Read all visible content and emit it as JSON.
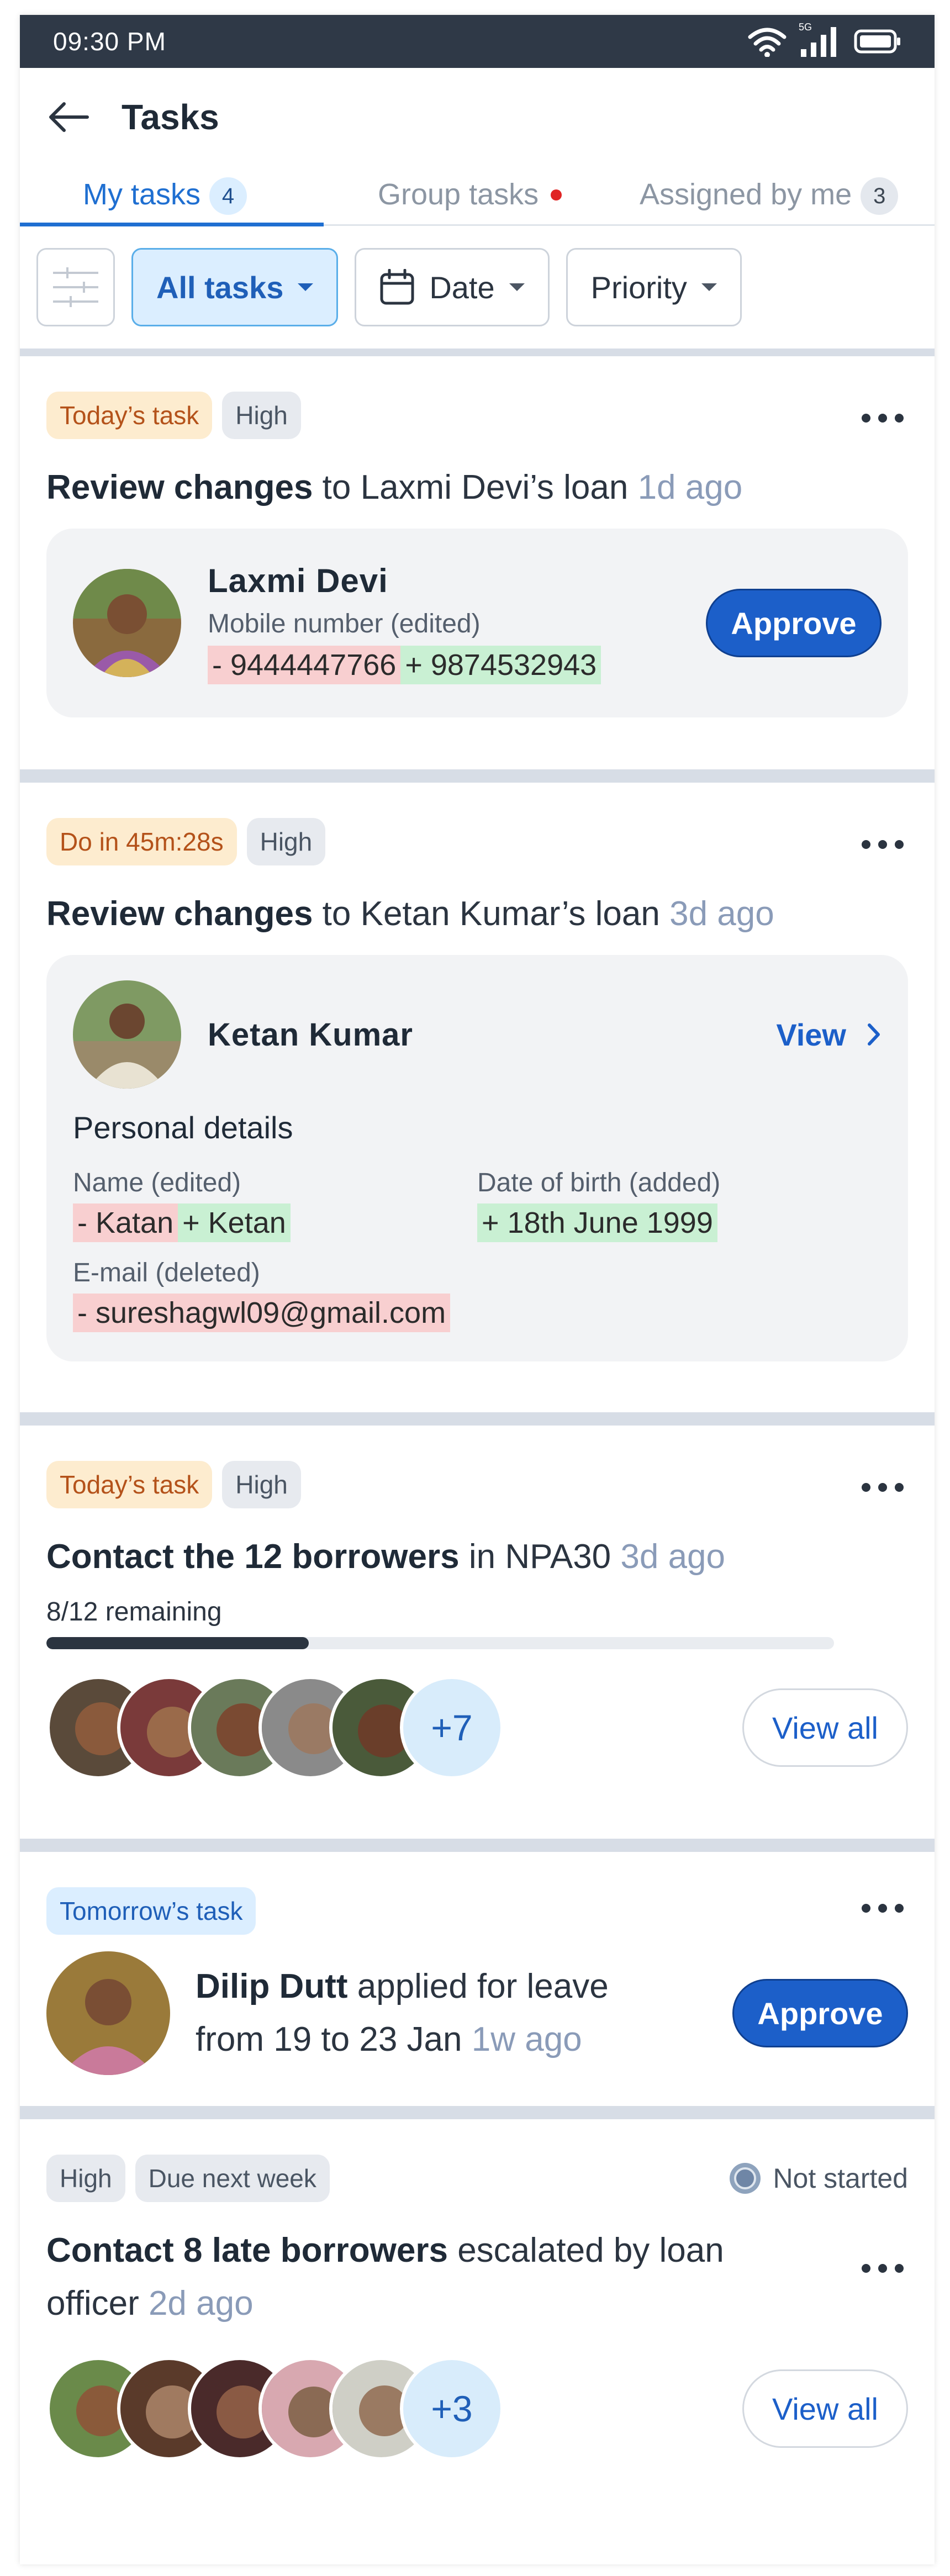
{
  "status_bar": {
    "time": "09:30 PM",
    "network": "5G"
  },
  "app_bar": {
    "title": "Tasks"
  },
  "tabs": [
    {
      "label": "My tasks",
      "count": "4",
      "active": true
    },
    {
      "label": "Group tasks",
      "has_dot": true,
      "active": false
    },
    {
      "label": "Assigned by me",
      "count": "3",
      "active": false
    }
  ],
  "filters": {
    "all_tasks": "All tasks",
    "date": "Date",
    "priority": "Priority"
  },
  "cards": [
    {
      "tag1": "Today’s task",
      "tag2": "High",
      "title_bold": "Review changes",
      "title_rest": " to Laxmi Devi’s loan ",
      "ago": "1d ago",
      "person": "Laxmi Devi",
      "field_label": "Mobile number (edited)",
      "old_value": "- 9444447766",
      "new_value": "+ 9874532943",
      "action": "Approve"
    },
    {
      "tag1": "Do in 45m:28s",
      "tag2": "High",
      "title_bold": "Review changes",
      "title_rest": " to Ketan Kumar’s loan ",
      "ago": "3d ago",
      "person": "Ketan Kumar",
      "view_label": "View",
      "section": "Personal details",
      "name_label": "Name (edited)",
      "name_old": "- Katan",
      "name_new": "+ Ketan",
      "dob_label": "Date of birth (added)",
      "dob_new": "+ 18th June 1999",
      "email_label": "E-mail (deleted)",
      "email_old": "- sureshagwl09@gmail.com"
    },
    {
      "tag1": "Today’s task",
      "tag2": "High",
      "title_bold": "Contact the 12 borrowers",
      "title_rest": " in NPA30 ",
      "ago": "3d ago",
      "progress_text": "8/12 remaining",
      "progress_fraction": 0.333,
      "extra_count": "+7",
      "action": "View all"
    },
    {
      "tag1": "Tomorrow’s task",
      "person": "Dilip Dutt",
      "line1_rest": " applied for leave",
      "line2": "from 19 to 23 Jan ",
      "ago": "1w ago",
      "action": "Approve"
    },
    {
      "tag1": "High",
      "tag2": "Due next week",
      "status": "Not started",
      "title_bold": "Contact 8 late borrowers",
      "title_rest": " escalated by loan officer ",
      "ago": "2d ago",
      "extra_count": "+3",
      "action": "View all"
    }
  ],
  "colors": {
    "primary": "#1c5fc9",
    "active_tab": "#1f6fd1",
    "deleted": "#f8cfd0",
    "added": "#c9f0d3",
    "status_bar": "#2f3947"
  }
}
